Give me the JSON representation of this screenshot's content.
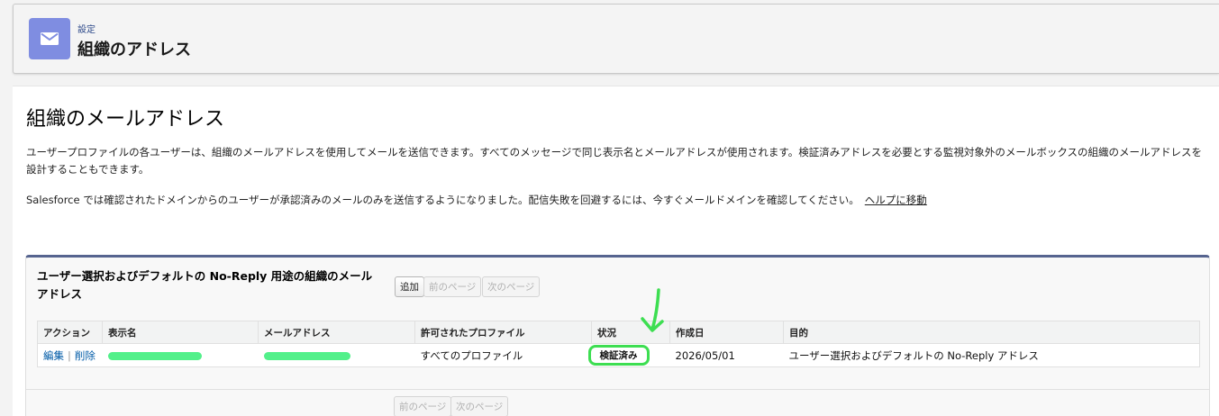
{
  "header": {
    "eyebrow": "設定",
    "title": "組織のアドレス",
    "icon": "envelope-icon",
    "icon_color": "#7f8de1"
  },
  "page": {
    "title": "組織のメールアドレス",
    "description_1": "ユーザープロファイルの各ユーザーは、組織のメールアドレスを使用してメールを送信できます。すべてのメッセージで同じ表示名とメールアドレスが使用されます。検証済みアドレスを必要とする監視対象外のメールボックスの組織のメールアドレスを設計することもできます。",
    "description_2": "Salesforce では確認されたドメインからのユーザーが承認済みのメールのみを送信するようになりました。配信失敗を回避するには、今すぐメールドメインを確認してください。",
    "help_link": "ヘルプに移動"
  },
  "panel": {
    "title": "ユーザー選択およびデフォルトの No-Reply 用途の組織のメールアドレス",
    "add_button": "追加",
    "prev_button": "前のページ",
    "next_button": "次のページ",
    "accent_color": "#56648f"
  },
  "table": {
    "columns": [
      "アクション",
      "表示名",
      "メールアドレス",
      "許可されたプロファイル",
      "状況",
      "作成日",
      "目的"
    ],
    "rows": [
      {
        "edit": "編集",
        "delete": "削除",
        "profiles": "すべてのプロファイル",
        "status": "検証済み",
        "created": "2026/05/01",
        "purpose": "ユーザー選択およびデフォルトの No-Reply アドレス"
      }
    ]
  },
  "annotation": {
    "highlight_color": "#3dde51",
    "arrow_icon": "arrow-down-icon"
  }
}
